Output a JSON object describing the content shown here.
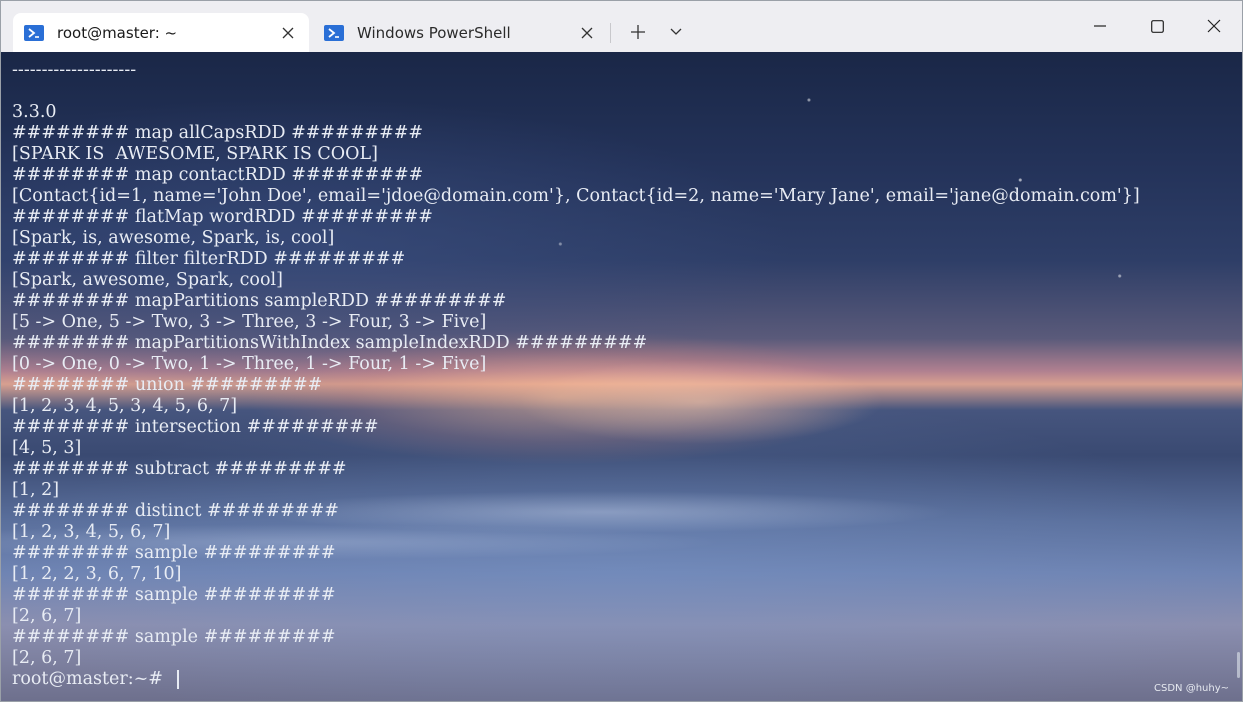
{
  "tabs": [
    {
      "label": "root@master: ~",
      "active": true,
      "icon": "powershell-icon"
    },
    {
      "label": "Windows PowerShell",
      "active": false,
      "icon": "powershell-icon"
    }
  ],
  "controls": {
    "new_tab": "+",
    "dropdown": "chevron-down-icon",
    "minimize": "minimize-icon",
    "maximize": "maximize-icon",
    "close": "close-icon"
  },
  "terminal": {
    "lines": [
      "---------------------",
      "",
      "3.3.0",
      "######## map allCapsRDD #########",
      "[SPARK IS  AWESOME, SPARK IS COOL]",
      "######## map contactRDD #########",
      "[Contact{id=1, name='John Doe', email='jdoe@domain.com'}, Contact{id=2, name='Mary Jane', email='jane@domain.com'}]",
      "######## flatMap wordRDD #########",
      "[Spark, is, awesome, Spark, is, cool]",
      "######## filter filterRDD #########",
      "[Spark, awesome, Spark, cool]",
      "######## mapPartitions sampleRDD #########",
      "[5 -> One, 5 -> Two, 3 -> Three, 3 -> Four, 3 -> Five]",
      "######## mapPartitionsWithIndex sampleIndexRDD #########",
      "[0 -> One, 0 -> Two, 1 -> Three, 1 -> Four, 1 -> Five]",
      "######## union #########",
      "[1, 2, 3, 4, 5, 3, 4, 5, 6, 7]",
      "######## intersection #########",
      "[4, 5, 3]",
      "######## subtract #########",
      "[1, 2]",
      "######## distinct #########",
      "[1, 2, 3, 4, 5, 6, 7]",
      "######## sample #########",
      "[1, 2, 2, 3, 6, 7, 10]",
      "######## sample #########",
      "[2, 6, 7]",
      "######## sample #########",
      "[2, 6, 7]"
    ],
    "prompt": "root@master:~# "
  },
  "watermark": "CSDN @huhy~",
  "colors": {
    "tab_active_bg": "#ffffff",
    "titlebar_bg": "#eeeef2",
    "terminal_text": "#e8ecf4",
    "ps_icon": "#2a6fd6"
  }
}
